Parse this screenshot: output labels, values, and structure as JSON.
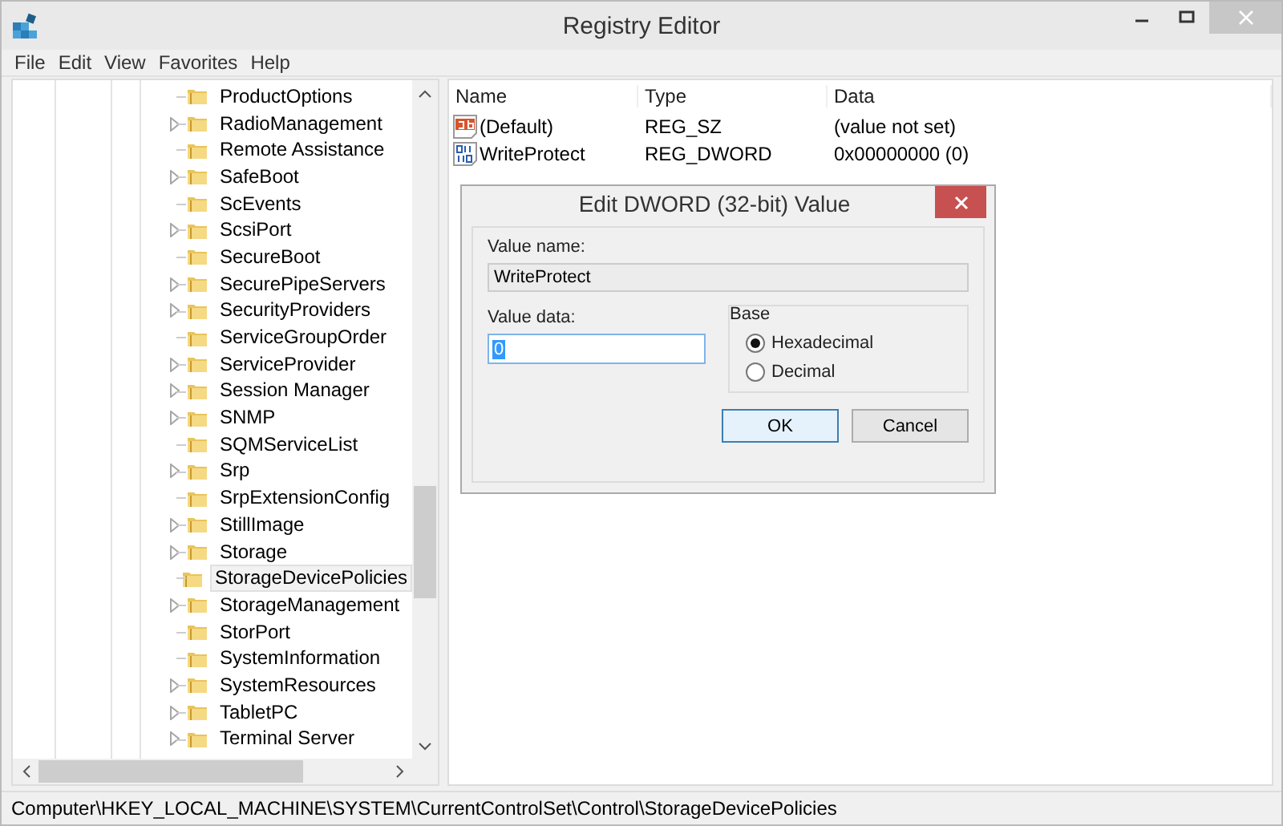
{
  "window": {
    "title": "Registry Editor"
  },
  "menu": [
    "File",
    "Edit",
    "View",
    "Favorites",
    "Help"
  ],
  "tree": [
    {
      "label": "ProductOptions",
      "expandable": false,
      "selected": false
    },
    {
      "label": "RadioManagement",
      "expandable": true,
      "selected": false
    },
    {
      "label": "Remote Assistance",
      "expandable": false,
      "selected": false
    },
    {
      "label": "SafeBoot",
      "expandable": true,
      "selected": false
    },
    {
      "label": "ScEvents",
      "expandable": false,
      "selected": false
    },
    {
      "label": "ScsiPort",
      "expandable": true,
      "selected": false
    },
    {
      "label": "SecureBoot",
      "expandable": false,
      "selected": false
    },
    {
      "label": "SecurePipeServers",
      "expandable": true,
      "selected": false
    },
    {
      "label": "SecurityProviders",
      "expandable": true,
      "selected": false
    },
    {
      "label": "ServiceGroupOrder",
      "expandable": false,
      "selected": false
    },
    {
      "label": "ServiceProvider",
      "expandable": true,
      "selected": false
    },
    {
      "label": "Session Manager",
      "expandable": true,
      "selected": false
    },
    {
      "label": "SNMP",
      "expandable": true,
      "selected": false
    },
    {
      "label": "SQMServiceList",
      "expandable": false,
      "selected": false
    },
    {
      "label": "Srp",
      "expandable": true,
      "selected": false
    },
    {
      "label": "SrpExtensionConfig",
      "expandable": false,
      "selected": false
    },
    {
      "label": "StillImage",
      "expandable": true,
      "selected": false
    },
    {
      "label": "Storage",
      "expandable": true,
      "selected": false
    },
    {
      "label": "StorageDevicePolicies",
      "expandable": false,
      "selected": true
    },
    {
      "label": "StorageManagement",
      "expandable": true,
      "selected": false
    },
    {
      "label": "StorPort",
      "expandable": false,
      "selected": false
    },
    {
      "label": "SystemInformation",
      "expandable": false,
      "selected": false
    },
    {
      "label": "SystemResources",
      "expandable": true,
      "selected": false
    },
    {
      "label": "TabletPC",
      "expandable": true,
      "selected": false
    },
    {
      "label": "Terminal Server",
      "expandable": true,
      "selected": false
    }
  ],
  "values": {
    "columns": [
      "Name",
      "Type",
      "Data"
    ],
    "rows": [
      {
        "kind": "string",
        "name": "(Default)",
        "type": "REG_SZ",
        "data": "(value not set)"
      },
      {
        "kind": "binary",
        "name": "WriteProtect",
        "type": "REG_DWORD",
        "data": "0x00000000 (0)"
      }
    ]
  },
  "dialog": {
    "title": "Edit DWORD (32-bit) Value",
    "value_name_label": "Value name:",
    "value_name": "WriteProtect",
    "value_data_label": "Value data:",
    "value_data": "0",
    "base_label": "Base",
    "base_options": [
      {
        "label": "Hexadecimal",
        "selected": true
      },
      {
        "label": "Decimal",
        "selected": false
      }
    ],
    "buttons": [
      {
        "label": "OK",
        "default": true
      },
      {
        "label": "Cancel",
        "default": false
      }
    ]
  },
  "status_bar": "Computer\\HKEY_LOCAL_MACHINE\\SYSTEM\\CurrentControlSet\\Control\\StorageDevicePolicies"
}
